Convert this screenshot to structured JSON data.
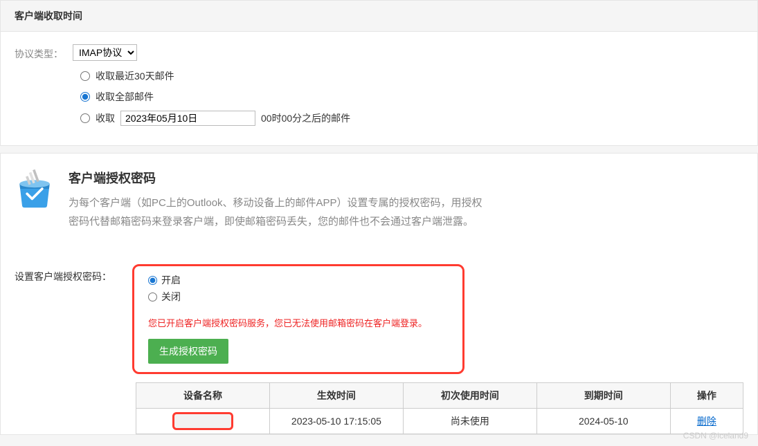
{
  "panel1": {
    "title": "客户端收取时间",
    "protocol_label": "协议类型：",
    "protocol_selected": "IMAP协议",
    "options": {
      "recent30": "收取最近30天邮件",
      "all": "收取全部邮件",
      "since_prefix": "收取",
      "since_date": "2023年05月10日",
      "since_suffix": "00时00分之后的邮件"
    }
  },
  "panel2": {
    "auth_title": "客户端授权密码",
    "auth_desc_line1": "为每个客户端（如PC上的Outlook、移动设备上的邮件APP）设置专属的授权密码，用授权",
    "auth_desc_line2": "密码代替邮箱密码来登录客户端，即使邮箱密码丢失，您的邮件也不会通过客户端泄露。",
    "setting_label": "设置客户端授权密码：",
    "toggle_on": "开启",
    "toggle_off": "关闭",
    "warning": "您已开启客户端授权密码服务，您已无法使用邮箱密码在客户端登录。",
    "generate_btn": "生成授权密码",
    "table": {
      "headers": {
        "device": "设备名称",
        "effective": "生效时间",
        "first_use": "初次使用时间",
        "expire": "到期时间",
        "action": "操作"
      },
      "rows": [
        {
          "device": "",
          "effective": "2023-05-10 17:15:05",
          "first_use": "尚未使用",
          "expire": "2024-05-10",
          "action": "删除"
        }
      ]
    }
  },
  "watermark": "CSDN @iceland9"
}
